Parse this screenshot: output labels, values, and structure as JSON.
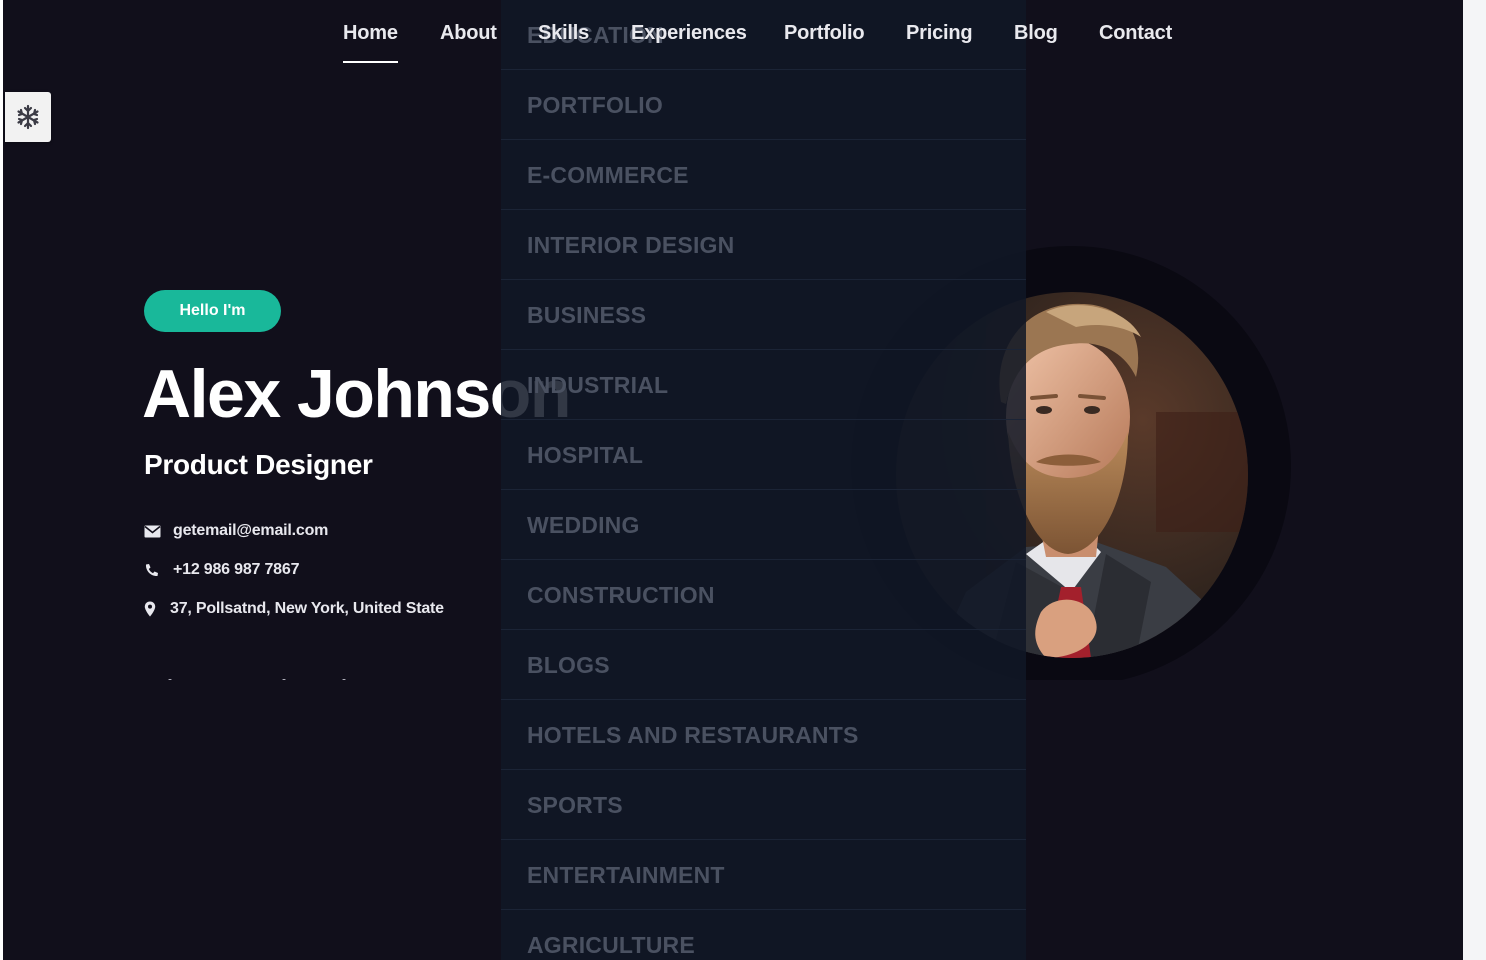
{
  "nav": {
    "items": [
      {
        "label": "Home",
        "active": true
      },
      {
        "label": "About"
      },
      {
        "label": "Skills"
      },
      {
        "label": "Experiences"
      },
      {
        "label": "Portfolio"
      },
      {
        "label": "Pricing"
      },
      {
        "label": "Blog"
      },
      {
        "label": "Contact"
      }
    ]
  },
  "settings": {
    "icon": "snowflake-gear-icon"
  },
  "hero": {
    "greeting": "Hello I'm",
    "name": "Alex Johnson",
    "role": "Product Designer",
    "contacts": {
      "email": "getemail@email.com",
      "phone": "+12 986 987 7867",
      "address": "37, Pollsatnd, New York, United State"
    },
    "avatar_icon": "bearded-man-portrait"
  },
  "menu": {
    "items": [
      {
        "label": "EDUCATION"
      },
      {
        "label": "PORTFOLIO"
      },
      {
        "label": "E-COMMERCE"
      },
      {
        "label": "INTERIOR DESIGN"
      },
      {
        "label": "BUSINESS"
      },
      {
        "label": "INDUSTRIAL"
      },
      {
        "label": "HOSPITAL"
      },
      {
        "label": "WEDDING"
      },
      {
        "label": "CONSTRUCTION"
      },
      {
        "label": "BLOGS"
      },
      {
        "label": "HOTELS AND RESTAURANTS"
      },
      {
        "label": "SPORTS"
      },
      {
        "label": "ENTERTAINMENT"
      },
      {
        "label": "AGRICULTURE"
      }
    ]
  },
  "colors": {
    "background": "#110f1b",
    "accent": "#19b89a",
    "menu_overlay": "#101726",
    "menu_text": "#4a5161"
  }
}
